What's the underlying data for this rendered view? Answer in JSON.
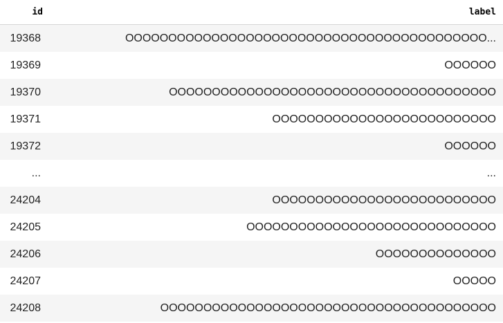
{
  "table": {
    "columns": [
      {
        "key": "id",
        "label": "id"
      },
      {
        "key": "label",
        "label": "label"
      }
    ],
    "rows": [
      {
        "id": "19368",
        "label": "OOOOOOOOOOOOOOOOOOOOOOOOOOOOOOOOOOOOOOOOOO..."
      },
      {
        "id": "19369",
        "label": "OOOOOO"
      },
      {
        "id": "19370",
        "label": "OOOOOOOOOOOOOOOOOOOOOOOOOOOOOOOOOOOOOO"
      },
      {
        "id": "19371",
        "label": "OOOOOOOOOOOOOOOOOOOOOOOOOO"
      },
      {
        "id": "19372",
        "label": "OOOOOO"
      },
      {
        "id": "...",
        "label": "..."
      },
      {
        "id": "24204",
        "label": "OOOOOOOOOOOOOOOOOOOOOOOOOO"
      },
      {
        "id": "24205",
        "label": "OOOOOOOOOOOOOOOOOOOOOOOOOOOOO"
      },
      {
        "id": "24206",
        "label": "OOOOOOOOOOOOOO"
      },
      {
        "id": "24207",
        "label": "OOOOO"
      },
      {
        "id": "24208",
        "label": "OOOOOOOOOOOOOOOOOOOOOOOOOOOOOOOOOOOOOOO"
      }
    ]
  }
}
